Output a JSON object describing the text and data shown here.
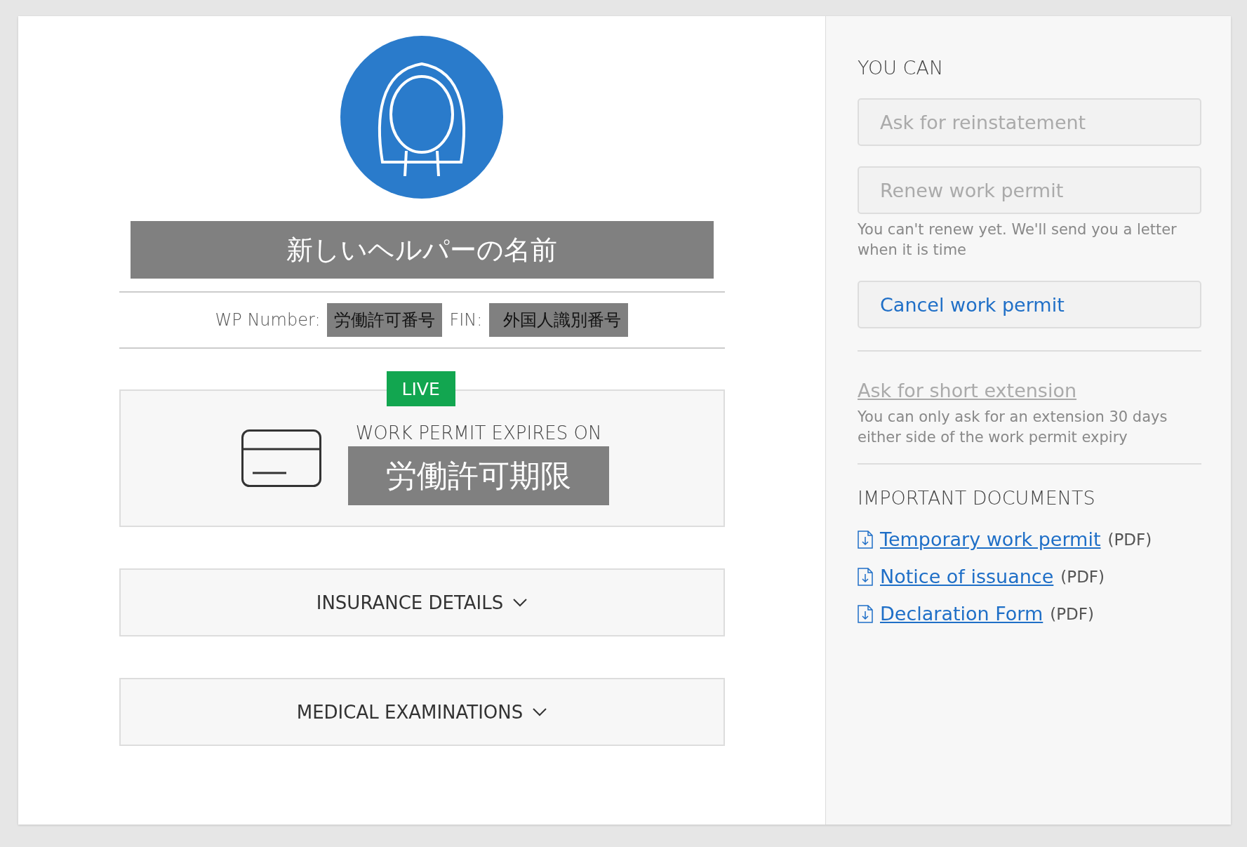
{
  "profile": {
    "name": "新しいヘルパーの名前",
    "wp_label": "WP Number:",
    "wp_number": "労働許可番号",
    "fin_label": "FIN:",
    "fin": "外国人識別番号"
  },
  "permit": {
    "status": "LIVE",
    "expires_label": "WORK PERMIT EXPIRES ON",
    "expiry": "労働許可期限"
  },
  "sections": [
    {
      "title": "INSURANCE DETAILS",
      "expanded": false
    },
    {
      "title": "MEDICAL EXAMINATIONS",
      "expanded": false
    }
  ],
  "actions": {
    "heading": "YOU CAN",
    "items": [
      {
        "kind": "button",
        "label": "Ask for reinstatement",
        "disabled": true
      },
      {
        "kind": "button",
        "label": "Renew work permit",
        "disabled": true,
        "note": "You can't renew yet. We'll send you a letter when it is time"
      },
      {
        "kind": "button",
        "label": "Cancel work permit",
        "disabled": false
      },
      {
        "kind": "link",
        "label": "Ask for short extension",
        "disabled": true,
        "note": "You can only ask for an extension 30 days either side of the work permit expiry"
      }
    ]
  },
  "documents": {
    "heading": "IMPORTANT DOCUMENTS",
    "items": [
      {
        "title": "Temporary work permit",
        "format": "(PDF)"
      },
      {
        "title": "Notice of issuance",
        "format": "(PDF)"
      },
      {
        "title": "Declaration Form",
        "format": "(PDF)"
      }
    ]
  }
}
